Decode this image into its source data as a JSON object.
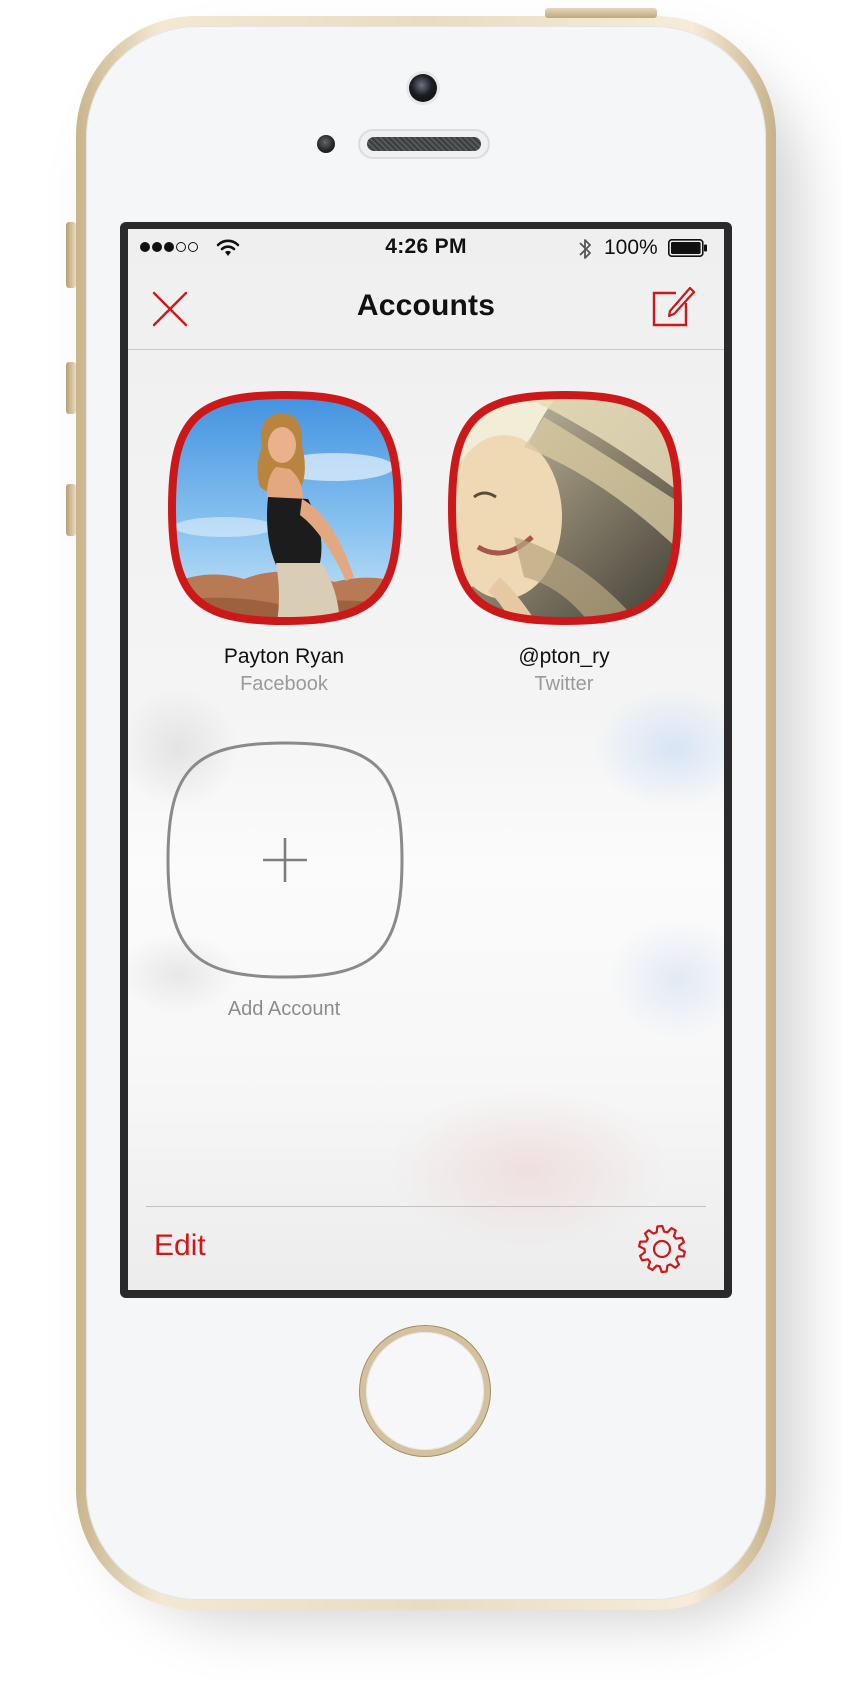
{
  "status_bar": {
    "signal_dots_filled": 3,
    "signal_dots_total": 5,
    "time": "4:26 PM",
    "battery_percent": "100%",
    "battery_level": 1.0
  },
  "nav": {
    "title": "Accounts",
    "close_icon": "close-icon",
    "compose_icon": "compose-icon"
  },
  "accounts": [
    {
      "name": "Payton Ryan",
      "service": "Facebook"
    },
    {
      "name": "@pton_ry",
      "service": "Twitter"
    }
  ],
  "add_account": {
    "label": "Add Account",
    "icon": "plus-icon"
  },
  "toolbar": {
    "edit_label": "Edit",
    "settings_icon": "gear-icon"
  },
  "colors": {
    "accent": "#cc1818",
    "secondary_text": "#9a9a9a",
    "add_outline": "#8a8a8a"
  }
}
